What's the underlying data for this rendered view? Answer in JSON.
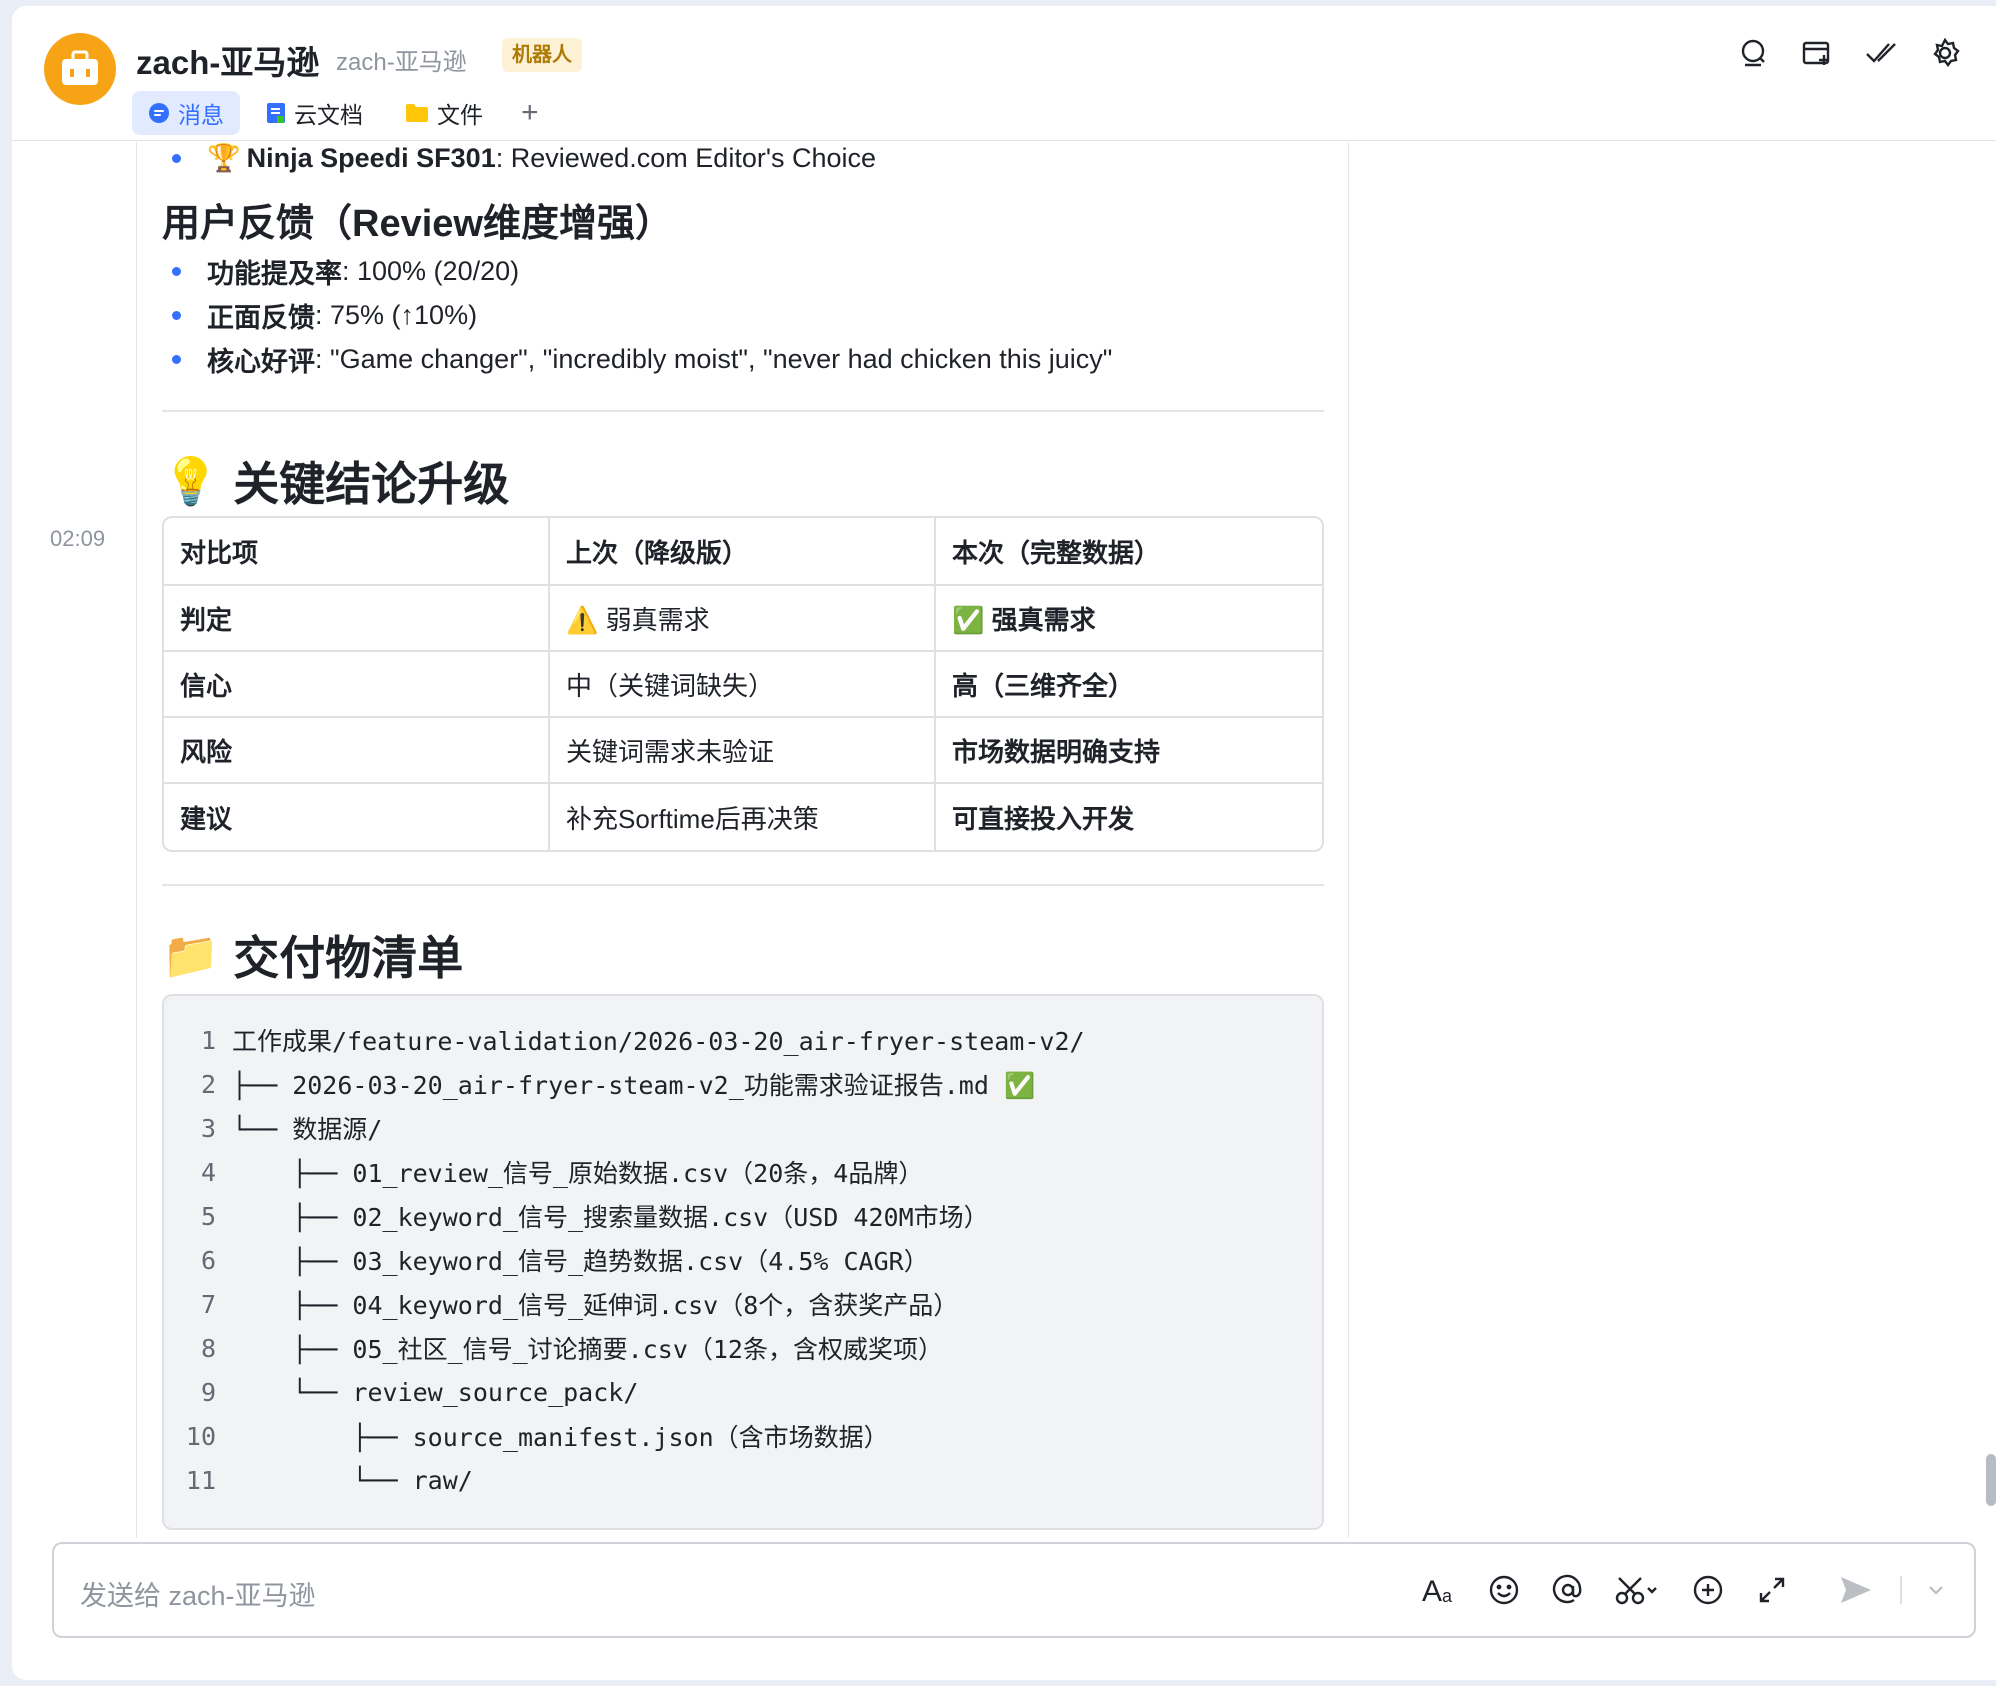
{
  "header": {
    "title": "zach-亚马逊",
    "subtitle": "zach-亚马逊",
    "badge": "机器人",
    "tabs": [
      {
        "label": "消息",
        "icon": "chat-bubble-icon"
      },
      {
        "label": "云文档",
        "icon": "doc-icon"
      },
      {
        "label": "文件",
        "icon": "folder-icon"
      }
    ],
    "add_tab": "+",
    "icons": [
      "search-chat-icon",
      "add-tab-icon",
      "double-check-icon",
      "settings-gear-icon"
    ]
  },
  "message": {
    "timestamp": "02:09",
    "award_item": {
      "icon": "🏆",
      "bold": "Ninja Speedi SF301",
      "text": ": Reviewed.com Editor's Choice"
    },
    "feedback_heading": "用户反馈（Review维度增强）",
    "feedback_items": [
      {
        "bold": "功能提及率",
        "text": ": 100% (20/20)"
      },
      {
        "bold": "正面反馈",
        "text": ": 75% (↑10%)"
      },
      {
        "bold": "核心好评",
        "text": ": \"Game changer\", \"incredibly moist\", \"never had chicken this juicy\""
      }
    ],
    "conclusion_heading": {
      "emoji": "💡",
      "text": "关键结论升级"
    },
    "table": {
      "headers": [
        "对比项",
        "上次（降级版）",
        "本次（完整数据）"
      ],
      "rows": [
        [
          "判定",
          "⚠️ 弱真需求",
          "✅ 强真需求"
        ],
        [
          "信心",
          "中（关键词缺失）",
          "高（三维齐全）"
        ],
        [
          "风险",
          "关键词需求未验证",
          "市场数据明确支持"
        ],
        [
          "建议",
          "补充Sorftime后再决策",
          "可直接投入开发"
        ]
      ]
    },
    "deliverables_heading": {
      "emoji": "📁",
      "text": "交付物清单"
    },
    "code_lines": [
      {
        "n": "1",
        "text": "工作成果/feature-validation/2026-03-20_air-fryer-steam-v2/"
      },
      {
        "n": "2",
        "text": "├── 2026-03-20_air-fryer-steam-v2_功能需求验证报告.md ✅"
      },
      {
        "n": "3",
        "text": "└── 数据源/"
      },
      {
        "n": "4",
        "text": "    ├── 01_review_信号_原始数据.csv（20条，4品牌）"
      },
      {
        "n": "5",
        "text": "    ├── 02_keyword_信号_搜索量数据.csv（USD 420M市场）"
      },
      {
        "n": "6",
        "text": "    ├── 03_keyword_信号_趋势数据.csv（4.5% CAGR）"
      },
      {
        "n": "7",
        "text": "    ├── 04_keyword_信号_延伸词.csv（8个，含获奖产品）"
      },
      {
        "n": "8",
        "text": "    ├── 05_社区_信号_讨论摘要.csv（12条，含权威奖项）"
      },
      {
        "n": "9",
        "text": "    └── review_source_pack/"
      },
      {
        "n": "10",
        "text": "        ├── source_manifest.json（含市场数据）"
      },
      {
        "n": "11",
        "text": "        └── raw/"
      }
    ]
  },
  "composer": {
    "placeholder": "发送给 zach-亚马逊",
    "tools": [
      "text-format-icon",
      "emoji-icon",
      "mention-icon",
      "scissors-icon",
      "add-circle-icon",
      "expand-icon",
      "send-icon",
      "send-options-chevron-icon"
    ]
  },
  "colors": {
    "accent": "#3370ff",
    "avatar": "#f6a416",
    "badge_bg": "#fdf1d6",
    "badge_text": "#b07b05"
  }
}
